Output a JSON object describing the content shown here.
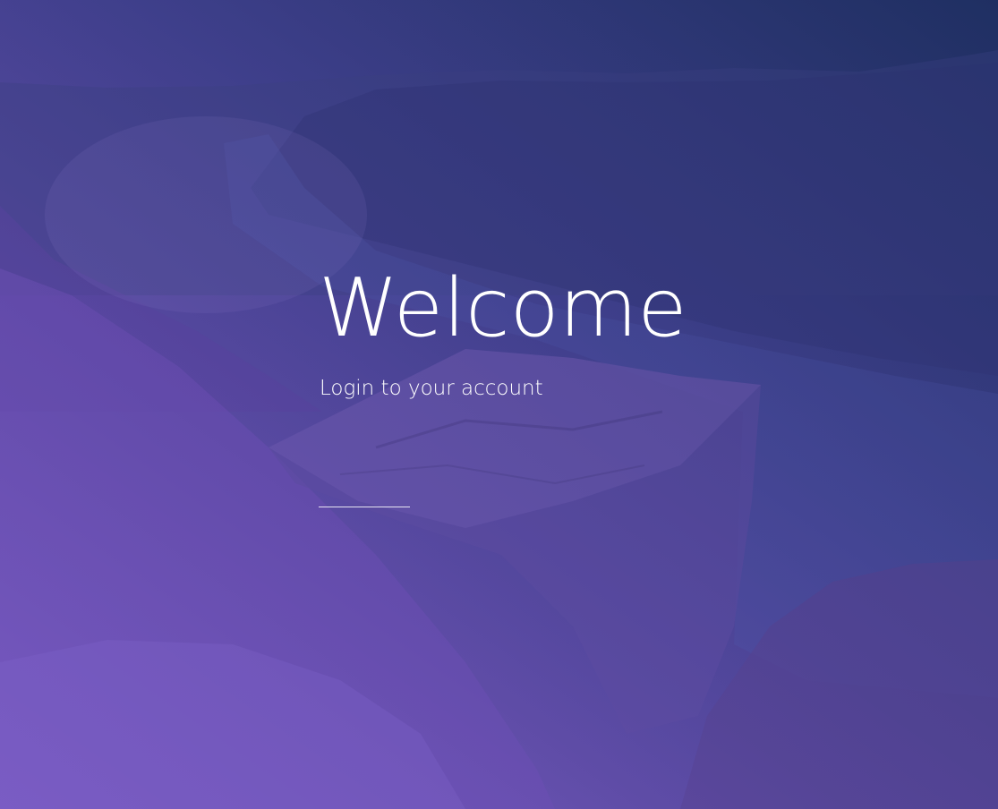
{
  "hero": {
    "title": "Welcome",
    "subtitle": "Login to your account"
  },
  "colors": {
    "gradient_start": "#7e5fc8",
    "gradient_end": "#1f2f62",
    "text": "#ffffff"
  }
}
